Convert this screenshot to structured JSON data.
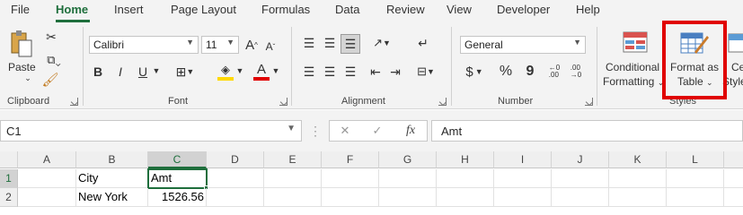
{
  "tabs": [
    "File",
    "Home",
    "Insert",
    "Page Layout",
    "Formulas",
    "Data",
    "Review",
    "View",
    "Developer",
    "Help"
  ],
  "ribbon": {
    "clipboard": {
      "paste_label": "Paste",
      "group_label": "Clipboard"
    },
    "font": {
      "name": "Calibri",
      "size": "11",
      "grow": "A",
      "shrink": "A",
      "bold": "B",
      "italic": "I",
      "underline": "U",
      "font_color_letter": "A",
      "group_label": "Font"
    },
    "alignment": {
      "group_label": "Alignment"
    },
    "number": {
      "format": "General",
      "currency": "$",
      "percent": "%",
      "comma": "9",
      "group_label": "Number"
    },
    "styles": {
      "conditional_line1": "Conditional",
      "conditional_line2": "Formatting",
      "format_table_line1": "Format as",
      "format_table_line2": "Table",
      "cell_styles_line1": "Ce",
      "cell_styles_line2": "Style",
      "group_label": "Styles"
    }
  },
  "formula_bar": {
    "name_box": "C1",
    "cancel": "✕",
    "enter": "✓",
    "fx": "fx",
    "content": "Amt"
  },
  "grid": {
    "columns": [
      "A",
      "B",
      "C",
      "D",
      "E",
      "F",
      "G",
      "H",
      "I",
      "J",
      "K",
      "L"
    ],
    "rows": [
      "1",
      "2"
    ],
    "cells": {
      "B1": "City",
      "C1": "Amt",
      "B2": "New York",
      "C2": "1526.56"
    }
  },
  "colors": {
    "accent": "#1e6e3c",
    "highlight": "#e00000",
    "font_color": "#e00000",
    "fill_color": "#ffd800"
  }
}
